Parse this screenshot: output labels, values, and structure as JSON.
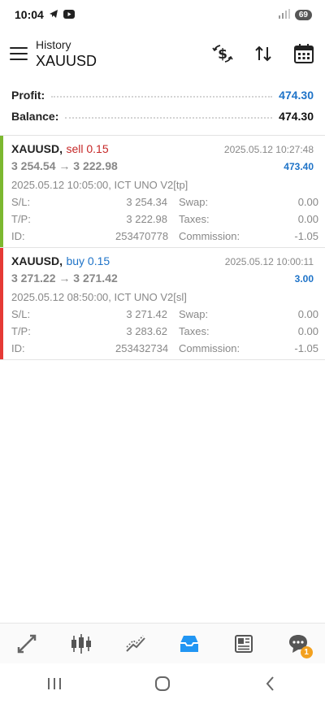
{
  "status_bar": {
    "time": "10:04",
    "battery": "69"
  },
  "header": {
    "subtitle": "History",
    "title": "XAUUSD"
  },
  "header_actions": [
    "currency-exchange-icon",
    "sort-icon",
    "calendar-icon"
  ],
  "summary": {
    "profit_label": "Profit:",
    "profit_value": "474.30",
    "balance_label": "Balance:",
    "balance_value": "474.30"
  },
  "labels": {
    "sl": "S/L:",
    "tp": "T/P:",
    "id": "ID:",
    "swap": "Swap:",
    "taxes": "Taxes:",
    "commission": "Commission:"
  },
  "trades": [
    {
      "symbol": "XAUUSD,",
      "direction": "sell 0.15",
      "close_time": "2025.05.12 10:27:48",
      "prices": "3 254.54 → 3 222.98",
      "profit": "473.40",
      "open_info": "2025.05.12 10:05:00, ICT UNO V2[tp]",
      "sl": "3 254.34",
      "tp": "3 222.98",
      "id": "253470778",
      "swap": "0.00",
      "taxes": "0.00",
      "commission": "-1.05"
    },
    {
      "symbol": "XAUUSD,",
      "direction": "buy 0.15",
      "close_time": "2025.05.12 10:00:11",
      "prices": "3 271.22 → 3 271.42",
      "profit": "3.00",
      "open_info": "2025.05.12 08:50:00, ICT UNO V2[sl]",
      "sl": "3 271.42",
      "tp": "3 283.62",
      "id": "253432734",
      "swap": "0.00",
      "taxes": "0.00",
      "commission": "-1.05"
    }
  ],
  "colors": {
    "sell": "#c62828",
    "buy": "#1e73c8",
    "sell_bar": "#7cb82f",
    "buy_bar": "#e53935",
    "profit": "#1e73c8",
    "active_nav": "#2196f3"
  },
  "bottom_nav": {
    "items": [
      "trade-icon",
      "chart-icon",
      "quotes-icon",
      "history-icon",
      "news-icon",
      "chat-icon"
    ],
    "chat_badge": "1"
  }
}
